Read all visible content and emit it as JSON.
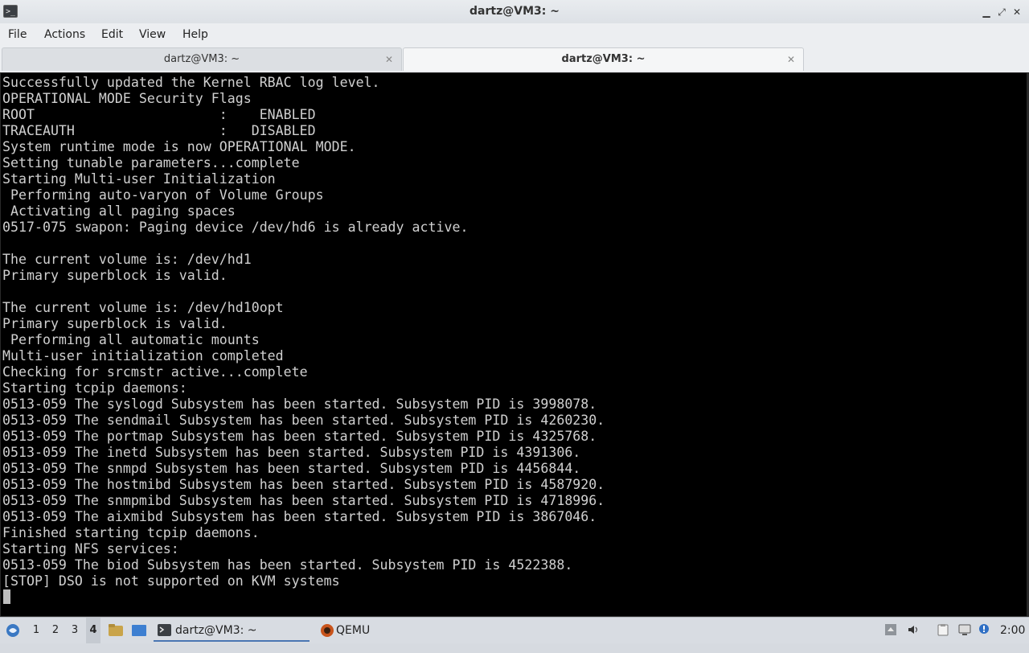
{
  "window": {
    "title": "dartz@VM3: ~",
    "app_icon_glyph": ">_",
    "controls": {
      "minimize": "▁",
      "restore": "⤢",
      "close": "✕"
    }
  },
  "menu": [
    "File",
    "Actions",
    "Edit",
    "View",
    "Help"
  ],
  "tabs": [
    {
      "label": "dartz@VM3: ~",
      "active": false,
      "close": "✕"
    },
    {
      "label": "dartz@VM3: ~",
      "active": true,
      "close": "✕"
    }
  ],
  "terminal": {
    "lines": [
      "Successfully updated the Kernel RBAC log level.",
      "OPERATIONAL MODE Security Flags",
      "ROOT                       :    ENABLED",
      "TRACEAUTH                  :   DISABLED",
      "System runtime mode is now OPERATIONAL MODE.",
      "Setting tunable parameters...complete",
      "Starting Multi-user Initialization",
      " Performing auto-varyon of Volume Groups",
      " Activating all paging spaces",
      "0517-075 swapon: Paging device /dev/hd6 is already active.",
      "",
      "The current volume is: /dev/hd1",
      "Primary superblock is valid.",
      "",
      "The current volume is: /dev/hd10opt",
      "Primary superblock is valid.",
      " Performing all automatic mounts",
      "Multi-user initialization completed",
      "Checking for srcmstr active...complete",
      "Starting tcpip daemons:",
      "0513-059 The syslogd Subsystem has been started. Subsystem PID is 3998078.",
      "0513-059 The sendmail Subsystem has been started. Subsystem PID is 4260230.",
      "0513-059 The portmap Subsystem has been started. Subsystem PID is 4325768.",
      "0513-059 The inetd Subsystem has been started. Subsystem PID is 4391306.",
      "0513-059 The snmpd Subsystem has been started. Subsystem PID is 4456844.",
      "0513-059 The hostmibd Subsystem has been started. Subsystem PID is 4587920.",
      "0513-059 The snmpmibd Subsystem has been started. Subsystem PID is 4718996.",
      "0513-059 The aixmibd Subsystem has been started. Subsystem PID is 3867046.",
      "Finished starting tcpip daemons.",
      "Starting NFS services:",
      "0513-059 The biod Subsystem has been started. Subsystem PID is 4522388.",
      "[STOP] DSO is not supported on KVM systems"
    ]
  },
  "taskbar": {
    "workspaces": [
      "1",
      "2",
      "3",
      "4"
    ],
    "active_workspace": "4",
    "tasks": [
      {
        "label": "dartz@VM3: ~",
        "icon": "terminal-icon",
        "active": true
      },
      {
        "label": "QEMU",
        "icon": "qemu-icon",
        "active": false
      }
    ],
    "clock": "2:00"
  },
  "colors": {
    "terminal_bg": "#000000",
    "terminal_fg": "#d0d0d0",
    "accent": "#4a76b3"
  }
}
